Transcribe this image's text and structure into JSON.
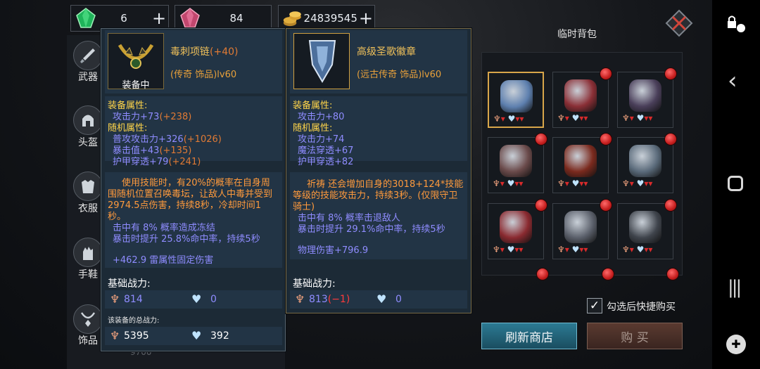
{
  "currency": {
    "green_gems": "6",
    "red_gems": "84",
    "gold": "24839545",
    "plus": "+"
  },
  "nav": {
    "weapon": "武器",
    "helmet": "头盔",
    "armor": "衣服",
    "gloves": "手鞋",
    "accessory": "饰品"
  },
  "left_item": {
    "name": "毒刺项链",
    "plus": "(+40)",
    "rarity": "(传奇 饰品)lv60",
    "equipped": "装备中",
    "attr_head": "装备属性:",
    "attack": "攻击力+73",
    "attack_bonus": "(+238)",
    "random_head": "随机属性:",
    "r1": "普攻攻击力+326",
    "r1_bonus": "(+1026)",
    "r2": "暴击值+43",
    "r2_bonus": "(+135)",
    "r3": "护甲穿透+79",
    "r3_bonus": "(+241)",
    "desc": "使用技能时，有20%的概率在自身周围随机位置召唤毒坛，让敌人中毒并受到2974.5点伤害，持续8秒，冷却时间1秒。",
    "e1": "击中有 8% 概率造成冻结",
    "e2": "暴击时提升 25.8%命中率，持续5秒",
    "e3": "+462.9 雷属性固定伤害",
    "power_head": "基础战力:",
    "power_fire": "814",
    "power_heart": "0",
    "total_head": "该装备的总战力:",
    "total_fire": "5395",
    "total_heart": "392"
  },
  "right_item": {
    "name": "高级圣歌徽章",
    "rarity": "(远古传奇 饰品)lv60",
    "attr_head": "装备属性:",
    "attack": "攻击力+80",
    "random_head": "随机属性:",
    "r1": "攻击力+74",
    "r2": "魔法穿透+67",
    "r3": "护甲穿透+82",
    "desc": "祈祷 还会增加自身的3018+124*技能等级的技能攻击力，持续3秒。(仅限守卫骑士)",
    "e1": "击中有 8% 概率击退敌人",
    "e2": "暴击时提升 29.1%命中率，持续5秒",
    "e3": "物理伤害+796.9",
    "power_head": "基础战力:",
    "power_fire": "813",
    "power_fire_diff": "(−1)",
    "power_heart": "0"
  },
  "bag": {
    "title": "临时背包",
    "quick_buy": "勾选后快捷购买",
    "refresh": "刷新商店",
    "buy": "购 买"
  },
  "colors": {
    "accent_gold": "#d8a64a",
    "stat_orange": "#e07a34",
    "stat_purple": "#8f8cff",
    "header_yellow": "#ffd54a",
    "teal_button": "#1f5d74"
  }
}
